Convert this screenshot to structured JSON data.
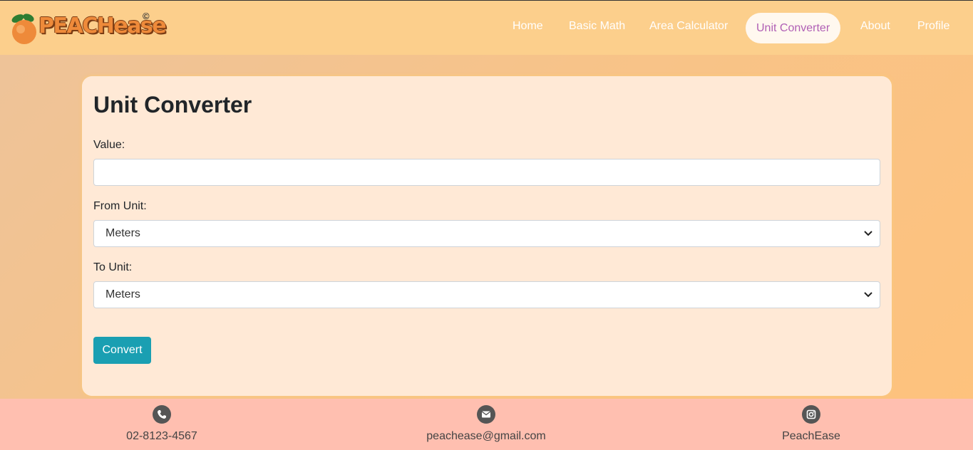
{
  "brand": {
    "name": "PEACHease",
    "mark": "©"
  },
  "nav": {
    "items": [
      {
        "label": "Home"
      },
      {
        "label": "Basic Math"
      },
      {
        "label": "Area Calculator"
      },
      {
        "label": "Unit Converter",
        "active": true
      },
      {
        "label": "About"
      },
      {
        "label": "Profile"
      }
    ]
  },
  "form": {
    "title": "Unit Converter",
    "value_label": "Value:",
    "value": "",
    "from_label": "From Unit:",
    "from_selected": "Meters",
    "to_label": "To Unit:",
    "to_selected": "Meters",
    "convert_label": "Convert"
  },
  "footer": {
    "phone": {
      "icon": "phone-icon",
      "text": "02-8123-4567"
    },
    "email": {
      "icon": "mail-icon",
      "text": "peachease@gmail.com"
    },
    "social": {
      "icon": "instagram-icon",
      "text": "PeachEase"
    }
  },
  "colors": {
    "navbar": "#fccf8c",
    "active_tab_text": "#b05fb5",
    "button": "#1a9fb2",
    "footer": "#ffbfb0",
    "card": "#ffe9d6"
  }
}
